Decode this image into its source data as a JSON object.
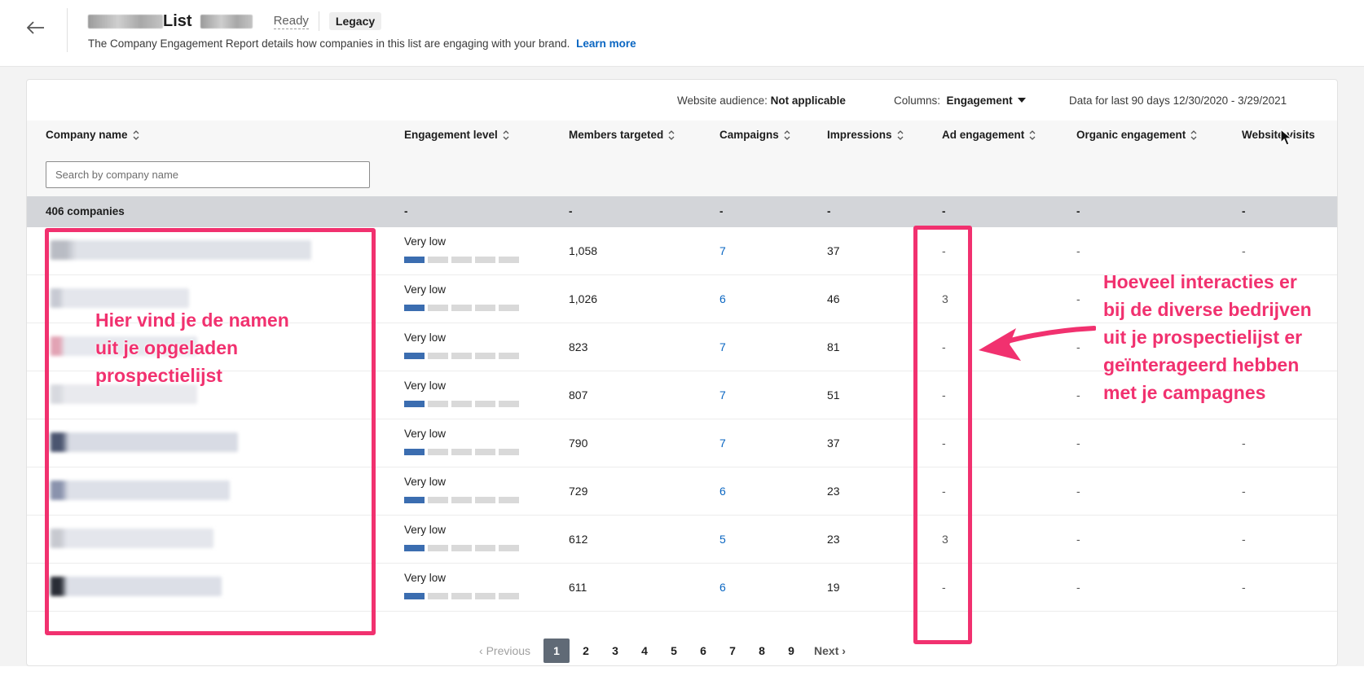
{
  "header": {
    "title_suffix": "List",
    "status": "Ready",
    "badge": "Legacy",
    "subtitle": "The Company Engagement Report details how companies in this list are engaging with your brand.",
    "learn_more": "Learn more"
  },
  "toolbar": {
    "audience_label": "Website audience:",
    "audience_value": "Not applicable",
    "columns_label": "Columns:",
    "columns_value": "Engagement",
    "date_range": "Data for last 90 days 12/30/2020 - 3/29/2021"
  },
  "columns": {
    "company": "Company name",
    "level": "Engagement level",
    "members": "Members targeted",
    "campaigns": "Campaigns",
    "impressions": "Impressions",
    "ad": "Ad engagement",
    "organic": "Organic engagement",
    "website": "Website visits"
  },
  "search": {
    "placeholder": "Search by company name"
  },
  "summary": {
    "count": "406 companies",
    "level": "-",
    "members": "-",
    "campaigns": "-",
    "impressions": "-",
    "ad": "-",
    "organic": "-",
    "website": "-"
  },
  "rows": [
    {
      "level": "Very low",
      "level_filled": 1,
      "members": "1,058",
      "campaigns": "7",
      "impressions": "37",
      "ad": "-",
      "organic": "-",
      "website": "-"
    },
    {
      "level": "Very low",
      "level_filled": 1,
      "members": "1,026",
      "campaigns": "6",
      "impressions": "46",
      "ad": "3",
      "organic": "-",
      "website": ""
    },
    {
      "level": "Very low",
      "level_filled": 1,
      "members": "823",
      "campaigns": "7",
      "impressions": "81",
      "ad": "-",
      "organic": "-",
      "website": ""
    },
    {
      "level": "Very low",
      "level_filled": 1,
      "members": "807",
      "campaigns": "7",
      "impressions": "51",
      "ad": "-",
      "organic": "-",
      "website": ""
    },
    {
      "level": "Very low",
      "level_filled": 1,
      "members": "790",
      "campaigns": "7",
      "impressions": "37",
      "ad": "-",
      "organic": "-",
      "website": "-"
    },
    {
      "level": "Very low",
      "level_filled": 1,
      "members": "729",
      "campaigns": "6",
      "impressions": "23",
      "ad": "-",
      "organic": "-",
      "website": "-"
    },
    {
      "level": "Very low",
      "level_filled": 1,
      "members": "612",
      "campaigns": "5",
      "impressions": "23",
      "ad": "3",
      "organic": "-",
      "website": "-"
    },
    {
      "level": "Very low",
      "level_filled": 1,
      "members": "611",
      "campaigns": "6",
      "impressions": "19",
      "ad": "-",
      "organic": "-",
      "website": "-"
    }
  ],
  "pagination": {
    "prev": "Previous",
    "next": "Next",
    "pages": [
      "1",
      "2",
      "3",
      "4",
      "5",
      "6",
      "7",
      "8",
      "9"
    ],
    "current": "1"
  },
  "annotations": {
    "left_lines": [
      "Hier vind je de namen",
      "uit je opgeladen",
      "prospectielijst"
    ],
    "right_lines": [
      "Hoeveel interacties er",
      "bij de diverse bedrijven",
      "uit je prospectielijst er",
      "geïnterageerd hebben",
      "met je campagnes"
    ],
    "color": "#f1316f"
  },
  "colors": {
    "link": "#0a66c2",
    "level_bar_filled": "#3b6db0",
    "summary_row_bg": "#d3d5d9",
    "active_page_bg": "#606a76"
  }
}
